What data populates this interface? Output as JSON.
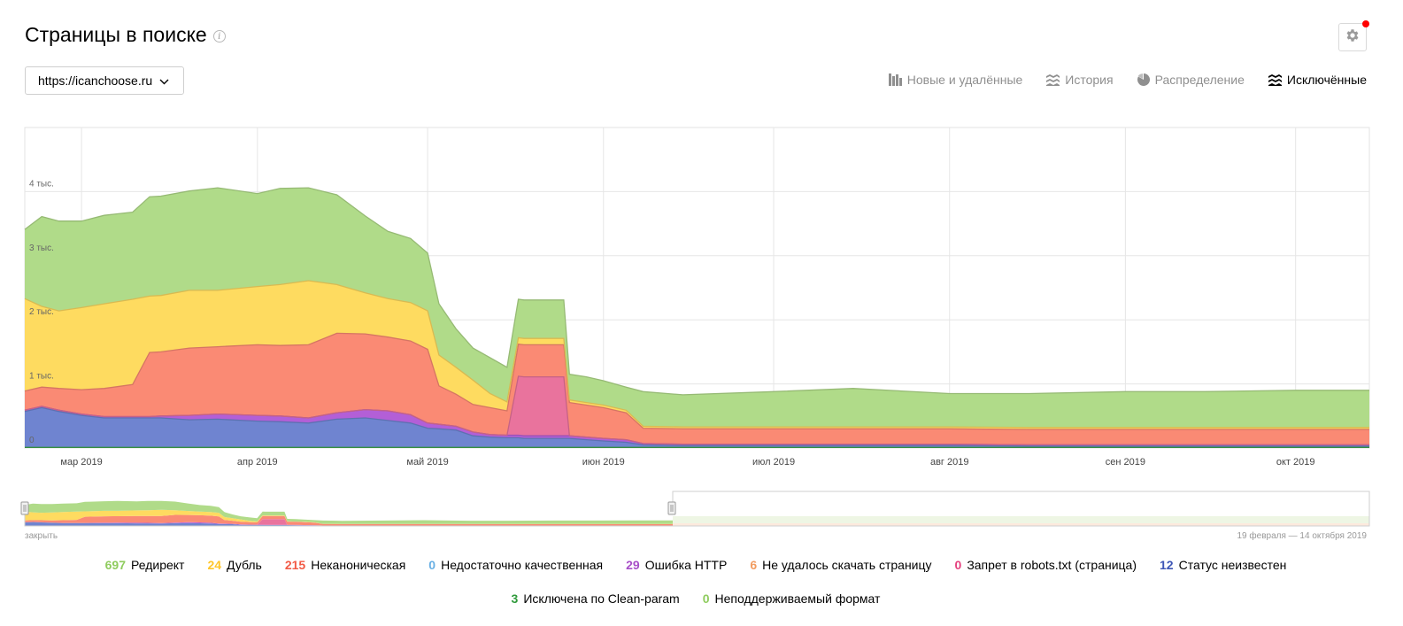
{
  "page": {
    "title": "Страницы в поиске",
    "info_icon": "info-icon",
    "settings_icon": "gear-icon",
    "settings_notification_color": "#ff0000"
  },
  "site_select": {
    "value": "https://icanchoose.ru",
    "icon": "chevron-down-icon"
  },
  "tabs": [
    {
      "label": "Новые и удалённые",
      "icon": "bars-icon",
      "active": false
    },
    {
      "label": "История",
      "icon": "stacked-area-icon",
      "active": false
    },
    {
      "label": "Распределение",
      "icon": "pie-icon",
      "active": false
    },
    {
      "label": "Исключённые",
      "icon": "stacked-area-icon",
      "active": true
    }
  ],
  "navigator": {
    "close_label": "закрыть",
    "range_label": "19 февраля — 14 октября 2019"
  },
  "chart_data": {
    "type": "area",
    "stacked": true,
    "x_start": "2019-02-19",
    "x_end": "2019-10-14",
    "x_ticks": [
      {
        "date": "2019-03-01",
        "label": "мар 2019"
      },
      {
        "date": "2019-04-01",
        "label": "апр 2019"
      },
      {
        "date": "2019-05-01",
        "label": "май 2019"
      },
      {
        "date": "2019-06-01",
        "label": "июн 2019"
      },
      {
        "date": "2019-07-01",
        "label": "июл 2019"
      },
      {
        "date": "2019-08-01",
        "label": "авг 2019"
      },
      {
        "date": "2019-09-01",
        "label": "сен 2019"
      },
      {
        "date": "2019-10-01",
        "label": "окт 2019"
      }
    ],
    "y_ticks": [
      {
        "value": 0,
        "label": "0"
      },
      {
        "value": 1000,
        "label": "1 тыс."
      },
      {
        "value": 2000,
        "label": "2 тыс."
      },
      {
        "value": 3000,
        "label": "3 тыс."
      },
      {
        "value": 4000,
        "label": "4 тыс."
      }
    ],
    "ylim": [
      0,
      5000
    ],
    "grid": true,
    "x": [
      "2019-02-19",
      "2019-02-22",
      "2019-02-25",
      "2019-03-01",
      "2019-03-05",
      "2019-03-10",
      "2019-03-13",
      "2019-03-15",
      "2019-03-20",
      "2019-03-25",
      "2019-04-01",
      "2019-04-05",
      "2019-04-10",
      "2019-04-15",
      "2019-04-20",
      "2019-04-24",
      "2019-04-28",
      "2019-05-01",
      "2019-05-03",
      "2019-05-06",
      "2019-05-09",
      "2019-05-12",
      "2019-05-15",
      "2019-05-17",
      "2019-05-18",
      "2019-05-25",
      "2019-05-26",
      "2019-05-29",
      "2019-06-01",
      "2019-06-05",
      "2019-06-08",
      "2019-06-15",
      "2019-07-01",
      "2019-07-15",
      "2019-08-01",
      "2019-08-15",
      "2019-09-01",
      "2019-09-15",
      "2019-10-01",
      "2019-10-14"
    ],
    "series": [
      {
        "name": "Статус неизвестен",
        "color": "#6f84d0",
        "values": [
          560,
          620,
          560,
          500,
          460,
          460,
          460,
          460,
          430,
          440,
          410,
          400,
          380,
          440,
          460,
          420,
          380,
          300,
          290,
          270,
          180,
          160,
          150,
          150,
          140,
          140,
          140,
          120,
          100,
          80,
          40,
          30,
          30,
          30,
          30,
          20,
          20,
          20,
          20,
          20
        ]
      },
      {
        "name": "Ошибка HTTP",
        "color": "#b35fd7",
        "values": [
          20,
          20,
          20,
          20,
          20,
          20,
          20,
          30,
          70,
          80,
          90,
          90,
          80,
          100,
          130,
          150,
          130,
          80,
          70,
          60,
          60,
          40,
          40,
          40,
          40,
          40,
          40,
          40,
          40,
          40,
          20,
          20,
          20,
          20,
          20,
          20,
          20,
          20,
          20,
          20
        ]
      },
      {
        "name": "Запрет в robots.txt (страница)",
        "color": "#e9739d",
        "values": [
          0,
          0,
          0,
          0,
          0,
          0,
          0,
          0,
          0,
          0,
          0,
          0,
          0,
          0,
          0,
          0,
          0,
          0,
          0,
          0,
          0,
          0,
          0,
          920,
          920,
          920,
          0,
          0,
          0,
          0,
          0,
          0,
          0,
          0,
          0,
          0,
          0,
          0,
          0,
          0
        ]
      },
      {
        "name": "Неканоническая",
        "color": "#fa8a74",
        "values": [
          300,
          300,
          340,
          380,
          440,
          500,
          1000,
          1000,
          1050,
          1050,
          1100,
          1100,
          1140,
          1240,
          1180,
          1150,
          1150,
          1150,
          600,
          500,
          430,
          420,
          380,
          500,
          500,
          500,
          520,
          500,
          480,
          420,
          240,
          240,
          240,
          240,
          240,
          240,
          240,
          240,
          240,
          240
        ]
      },
      {
        "name": "Дубль",
        "color": "#fedb60",
        "values": [
          1440,
          1260,
          1210,
          1280,
          1320,
          1330,
          880,
          880,
          900,
          880,
          910,
          950,
          1000,
          760,
          640,
          600,
          600,
          600,
          480,
          420,
          380,
          220,
          140,
          100,
          100,
          100,
          40,
          40,
          40,
          40,
          30,
          30,
          30,
          30,
          30,
          30,
          30,
          30,
          30,
          30
        ]
      },
      {
        "name": "Редирект",
        "color": "#b0db89",
        "values": [
          1080,
          1400,
          1400,
          1350,
          1380,
          1360,
          1550,
          1550,
          1550,
          1600,
          1450,
          1500,
          1450,
          1400,
          1200,
          1050,
          1000,
          900,
          800,
          600,
          500,
          560,
          540,
          600,
          600,
          600,
          400,
          400,
          380,
          360,
          540,
          500,
          550,
          600,
          520,
          530,
          560,
          560,
          580,
          580
        ]
      },
      {
        "name": "Недостаточно качественная",
        "color": "#69b0e4",
        "values": [
          0,
          0,
          0,
          0,
          0,
          0,
          0,
          0,
          0,
          0,
          0,
          0,
          0,
          0,
          0,
          0,
          0,
          0,
          0,
          0,
          0,
          0,
          0,
          0,
          0,
          0,
          0,
          0,
          0,
          0,
          0,
          0,
          0,
          0,
          0,
          0,
          0,
          0,
          0,
          0
        ]
      },
      {
        "name": "Не удалось скачать страницу",
        "color": "#f29c60",
        "values": [
          0,
          0,
          0,
          0,
          0,
          0,
          0,
          0,
          0,
          0,
          0,
          0,
          0,
          0,
          0,
          0,
          0,
          0,
          0,
          0,
          0,
          0,
          0,
          0,
          0,
          0,
          0,
          0,
          0,
          0,
          0,
          0,
          0,
          0,
          0,
          0,
          0,
          0,
          0,
          0
        ]
      },
      {
        "name": "Исключена по Clean-param",
        "color": "#41a84d",
        "values": [
          10,
          10,
          10,
          10,
          10,
          10,
          10,
          10,
          10,
          10,
          10,
          10,
          10,
          10,
          10,
          10,
          10,
          10,
          10,
          10,
          10,
          10,
          10,
          10,
          10,
          10,
          10,
          10,
          10,
          10,
          10,
          10,
          10,
          10,
          10,
          10,
          10,
          10,
          10,
          10
        ]
      },
      {
        "name": "Неподдерживаемый формат",
        "color": "#8fcc5e",
        "values": [
          0,
          0,
          0,
          0,
          0,
          0,
          0,
          0,
          0,
          0,
          0,
          0,
          0,
          0,
          0,
          0,
          0,
          0,
          0,
          0,
          0,
          0,
          0,
          0,
          0,
          0,
          0,
          0,
          0,
          0,
          0,
          0,
          0,
          0,
          0,
          0,
          0,
          0,
          0,
          0
        ]
      }
    ],
    "stack_order": [
      "Исключена по Clean-param",
      "Статус неизвестен",
      "Ошибка HTTP",
      "Запрет в robots.txt (страница)",
      "Неканоническая",
      "Дубль",
      "Редирект"
    ]
  },
  "legend": {
    "rows": [
      [
        {
          "count": "697",
          "label": "Редирект",
          "color": "#8fcc5e"
        },
        {
          "count": "24",
          "label": "Дубль",
          "color": "#ffc62b"
        },
        {
          "count": "215",
          "label": "Неканоническая",
          "color": "#f25a45"
        },
        {
          "count": "0",
          "label": "Недостаточно качественная",
          "color": "#69b0e4"
        },
        {
          "count": "29",
          "label": "Ошибка HTTP",
          "color": "#a74fc8"
        },
        {
          "count": "6",
          "label": "Не удалось скачать страницу",
          "color": "#f29c60"
        },
        {
          "count": "0",
          "label": "Запрет в robots.txt (страница)",
          "color": "#e5417e"
        },
        {
          "count": "12",
          "label": "Статус неизвестен",
          "color": "#3e56b6"
        }
      ],
      [
        {
          "count": "3",
          "label": "Исключена по Clean-param",
          "color": "#2f9a3b"
        },
        {
          "count": "0",
          "label": "Неподдерживаемый формат",
          "color": "#8fcc5e"
        }
      ]
    ]
  }
}
